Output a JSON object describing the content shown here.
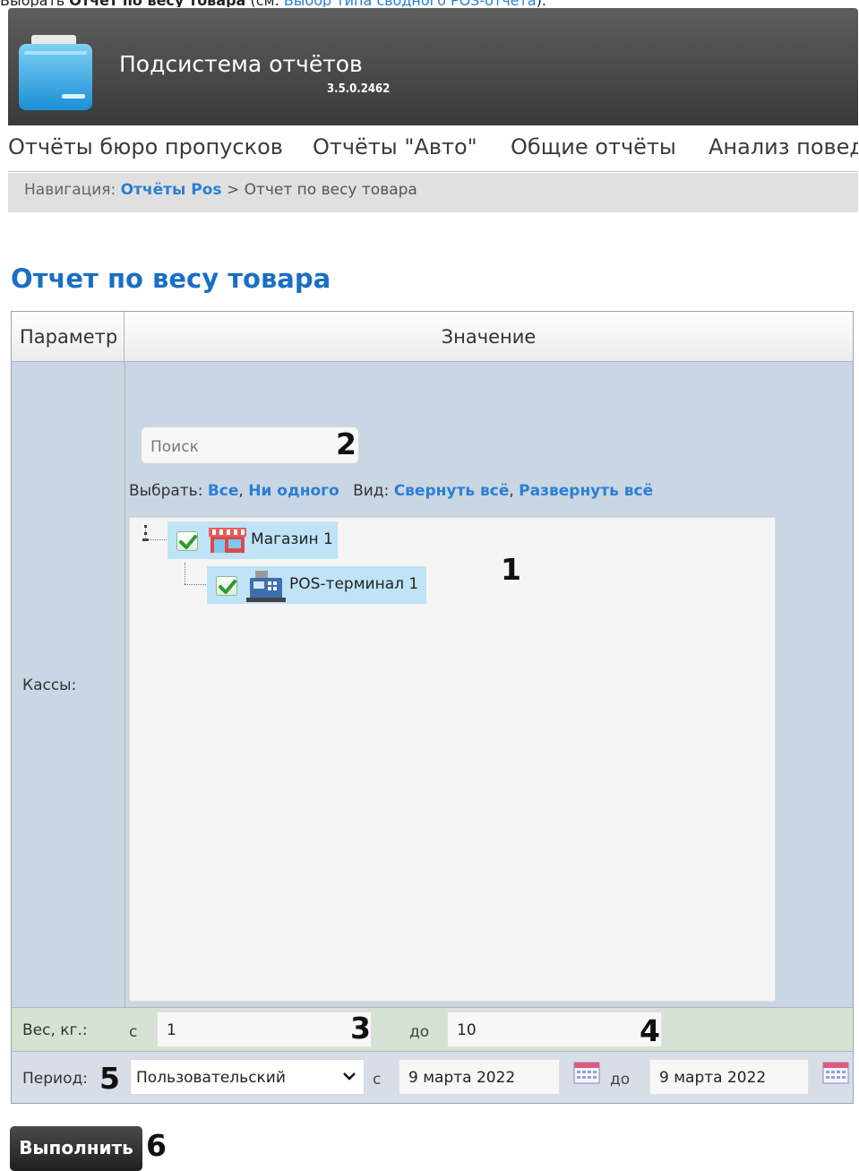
{
  "intro": {
    "prefix": "Выбрать",
    "bold": "Отчет по весу товара",
    "middle": "(см.",
    "link": "Выбор типа сводного POS-отчета",
    "suffix": ")."
  },
  "header": {
    "title": "Подсистема отчётов",
    "version": "3.5.0.2462"
  },
  "nav": {
    "items": [
      {
        "label": "Отчёты бюро пропусков"
      },
      {
        "label": "Отчёты \"Авто\""
      },
      {
        "label": "Общие отчёты"
      },
      {
        "label": "Анализ повед"
      }
    ]
  },
  "breadcrumb": {
    "label": "Навигация:",
    "link": "Отчёты Pos",
    "separator": ">",
    "current": "Отчет по весу товара"
  },
  "page_title": "Отчет по весу товара",
  "table": {
    "col_param": "Параметр",
    "col_value": "Значение"
  },
  "kassy": {
    "label": "Кассы:",
    "search_placeholder": "Поиск",
    "select_label": "Выбрать:",
    "select_all": "Все",
    "comma": ",",
    "select_none": "Ни одного",
    "view_label": "Вид:",
    "collapse_all": "Свернуть всё",
    "expand_all": "Развернуть всё",
    "tree": [
      {
        "label": "Магазин 1",
        "checked": true,
        "icon": "store-icon"
      },
      {
        "label": "POS-терминал 1",
        "checked": true,
        "icon": "pos-terminal-icon"
      }
    ]
  },
  "weight": {
    "label": "Вес, кг.:",
    "from_label": "с",
    "from_value": "1",
    "to_label": "до",
    "to_value": "10"
  },
  "period": {
    "label": "Период:",
    "selected": "Пользовательский",
    "from_label": "с",
    "from_date": "9 марта 2022",
    "to_label": "до",
    "to_date": "9 марта 2022"
  },
  "run_button": "Выполнить",
  "markers": {
    "m1": "1",
    "m2": "2",
    "m3": "3",
    "m4": "4",
    "m5": "5",
    "m6": "6"
  },
  "colors": {
    "header_bg": "#4a4a4a",
    "link": "#2a7fd4",
    "title": "#1a6fc4",
    "weight_row_bg": "#d6e2d3",
    "period_row_bg": "#d7dee8",
    "tree_selected_bg": "#bfe3f7"
  }
}
